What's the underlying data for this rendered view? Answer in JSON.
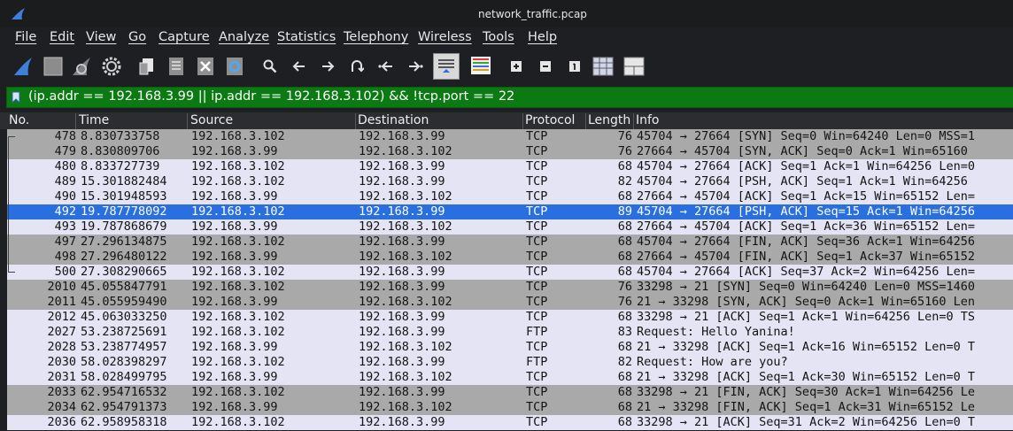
{
  "window": {
    "title": "network_traffic.pcap"
  },
  "menu": [
    "File",
    "Edit",
    "View",
    "Go",
    "Capture",
    "Analyze",
    "Statistics",
    "Telephony",
    "Wireless",
    "Tools",
    "Help"
  ],
  "toolbar": {
    "icons": [
      "start-capture-icon",
      "stop-capture-icon",
      "restart-capture-icon",
      "capture-options-icon",
      "open-file-icon",
      "save-file-icon",
      "close-file-icon",
      "reload-file-icon",
      "find-packet-icon",
      "go-back-icon",
      "go-forward-icon",
      "go-to-packet-icon",
      "go-first-packet-icon",
      "go-last-packet-icon",
      "autoscroll-icon",
      "colorize-icon",
      "zoom-in-icon",
      "zoom-out-icon",
      "normal-size-icon",
      "resize-columns-icon",
      "layout-icon"
    ]
  },
  "filter": {
    "text": "(ip.addr == 192.168.3.99 || ip.addr == 192.168.3.102) && !tcp.port == 22"
  },
  "columns": [
    "No.",
    "Time",
    "Source",
    "Destination",
    "Protocol",
    "Length",
    "Info"
  ],
  "packets": [
    {
      "no": "478",
      "time": "8.830733758",
      "src": "192.168.3.102",
      "dst": "192.168.3.99",
      "proto": "TCP",
      "len": "76",
      "info": "45704 → 27664 [SYN] Seq=0 Win=64240 Len=0 MSS=1",
      "style": "gray"
    },
    {
      "no": "479",
      "time": "8.830809706",
      "src": "192.168.3.99",
      "dst": "192.168.3.102",
      "proto": "TCP",
      "len": "76",
      "info": "27664 → 45704 [SYN, ACK] Seq=0 Ack=1 Win=65160",
      "style": "gray"
    },
    {
      "no": "480",
      "time": "8.833727739",
      "src": "192.168.3.102",
      "dst": "192.168.3.99",
      "proto": "TCP",
      "len": "68",
      "info": "45704 → 27664 [ACK] Seq=1 Ack=1 Win=64256 Len=0",
      "style": "light"
    },
    {
      "no": "489",
      "time": "15.301882484",
      "src": "192.168.3.102",
      "dst": "192.168.3.99",
      "proto": "TCP",
      "len": "82",
      "info": "45704 → 27664 [PSH, ACK] Seq=1 Ack=1 Win=64256",
      "style": "light"
    },
    {
      "no": "490",
      "time": "15.301948593",
      "src": "192.168.3.99",
      "dst": "192.168.3.102",
      "proto": "TCP",
      "len": "68",
      "info": "27664 → 45704 [ACK] Seq=1 Ack=15 Win=65152 Len=",
      "style": "light"
    },
    {
      "no": "492",
      "time": "19.787778092",
      "src": "192.168.3.102",
      "dst": "192.168.3.99",
      "proto": "TCP",
      "len": "89",
      "info": "45704 → 27664 [PSH, ACK] Seq=15 Ack=1 Win=64256",
      "style": "sel"
    },
    {
      "no": "493",
      "time": "19.787868679",
      "src": "192.168.3.99",
      "dst": "192.168.3.102",
      "proto": "TCP",
      "len": "68",
      "info": "27664 → 45704 [ACK] Seq=1 Ack=36 Win=65152 Len=",
      "style": "light"
    },
    {
      "no": "497",
      "time": "27.296134875",
      "src": "192.168.3.102",
      "dst": "192.168.3.99",
      "proto": "TCP",
      "len": "68",
      "info": "45704 → 27664 [FIN, ACK] Seq=36 Ack=1 Win=64256",
      "style": "gray"
    },
    {
      "no": "498",
      "time": "27.296480122",
      "src": "192.168.3.99",
      "dst": "192.168.3.102",
      "proto": "TCP",
      "len": "68",
      "info": "27664 → 45704 [FIN, ACK] Seq=1 Ack=37 Win=65152",
      "style": "gray"
    },
    {
      "no": "500",
      "time": "27.308290665",
      "src": "192.168.3.102",
      "dst": "192.168.3.99",
      "proto": "TCP",
      "len": "68",
      "info": "45704 → 27664 [ACK] Seq=37 Ack=2 Win=64256 Len=",
      "style": "light"
    },
    {
      "no": "2010",
      "time": "45.055847791",
      "src": "192.168.3.102",
      "dst": "192.168.3.99",
      "proto": "TCP",
      "len": "76",
      "info": "33298 → 21 [SYN] Seq=0 Win=64240 Len=0 MSS=1460",
      "style": "gray"
    },
    {
      "no": "2011",
      "time": "45.055959490",
      "src": "192.168.3.99",
      "dst": "192.168.3.102",
      "proto": "TCP",
      "len": "76",
      "info": "21 → 33298 [SYN, ACK] Seq=0 Ack=1 Win=65160 Len",
      "style": "gray"
    },
    {
      "no": "2012",
      "time": "45.063033250",
      "src": "192.168.3.102",
      "dst": "192.168.3.99",
      "proto": "TCP",
      "len": "68",
      "info": "33298 → 21 [ACK] Seq=1 Ack=1 Win=64256 Len=0 TS",
      "style": "light"
    },
    {
      "no": "2027",
      "time": "53.238725691",
      "src": "192.168.3.102",
      "dst": "192.168.3.99",
      "proto": "FTP",
      "len": "83",
      "info": "Request: Hello Yanina!",
      "style": "light"
    },
    {
      "no": "2028",
      "time": "53.238774957",
      "src": "192.168.3.99",
      "dst": "192.168.3.102",
      "proto": "TCP",
      "len": "68",
      "info": "21 → 33298 [ACK] Seq=1 Ack=16 Win=65152 Len=0 T",
      "style": "light"
    },
    {
      "no": "2030",
      "time": "58.028398297",
      "src": "192.168.3.102",
      "dst": "192.168.3.99",
      "proto": "FTP",
      "len": "82",
      "info": "Request: How are you?",
      "style": "light"
    },
    {
      "no": "2031",
      "time": "58.028499795",
      "src": "192.168.3.99",
      "dst": "192.168.3.102",
      "proto": "TCP",
      "len": "68",
      "info": "21 → 33298 [ACK] Seq=1 Ack=30 Win=65152 Len=0 T",
      "style": "light"
    },
    {
      "no": "2033",
      "time": "62.954716532",
      "src": "192.168.3.102",
      "dst": "192.168.3.99",
      "proto": "TCP",
      "len": "68",
      "info": "33298 → 21 [FIN, ACK] Seq=30 Ack=1 Win=64256 Le",
      "style": "gray"
    },
    {
      "no": "2034",
      "time": "62.954791373",
      "src": "192.168.3.99",
      "dst": "192.168.3.102",
      "proto": "TCP",
      "len": "68",
      "info": "21 → 33298 [FIN, ACK] Seq=1 Ack=31 Win=65152 Le",
      "style": "gray"
    },
    {
      "no": "2036",
      "time": "62.958958318",
      "src": "192.168.3.102",
      "dst": "192.168.3.99",
      "proto": "TCP",
      "len": "68",
      "info": "33298 → 21 [ACK] Seq=31 Ack=2 Win=64256 Len=0 T",
      "style": "light"
    }
  ]
}
